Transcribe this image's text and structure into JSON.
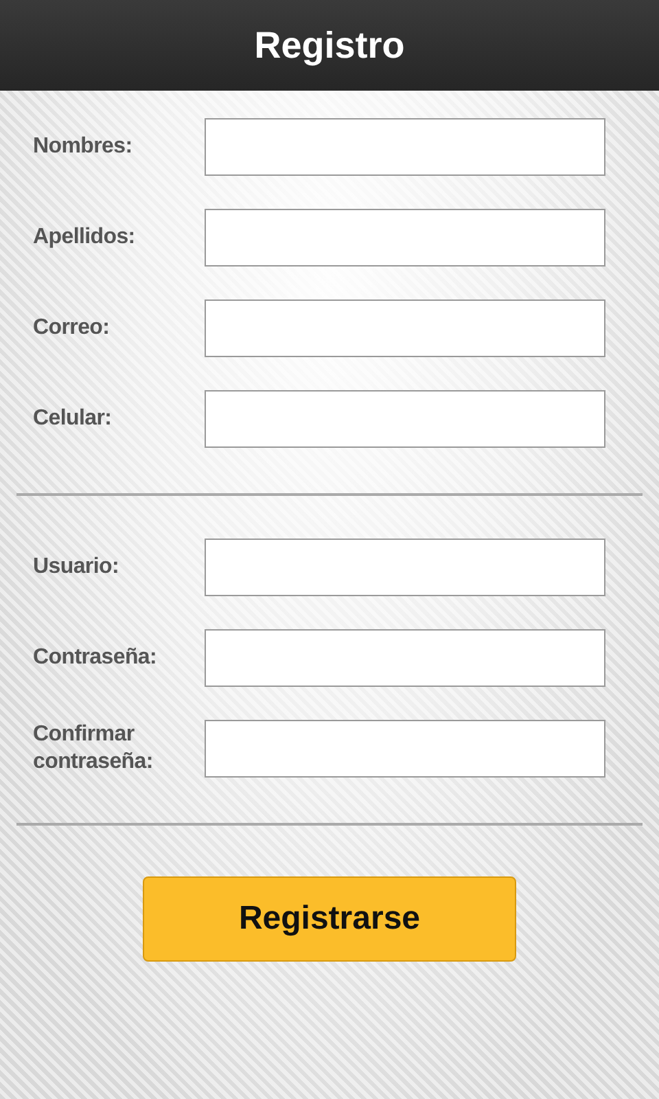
{
  "header": {
    "title": "Registro"
  },
  "sections": [
    {
      "fields": [
        {
          "label": "Nombres:"
        },
        {
          "label": "Apellidos:"
        },
        {
          "label": "Correo:"
        },
        {
          "label": "Celular:"
        }
      ]
    },
    {
      "fields": [
        {
          "label": "Usuario:"
        },
        {
          "label": "Contraseña:"
        },
        {
          "label": "Confirmar contraseña:"
        }
      ]
    }
  ],
  "submit_button": {
    "label": "Registrarse"
  }
}
